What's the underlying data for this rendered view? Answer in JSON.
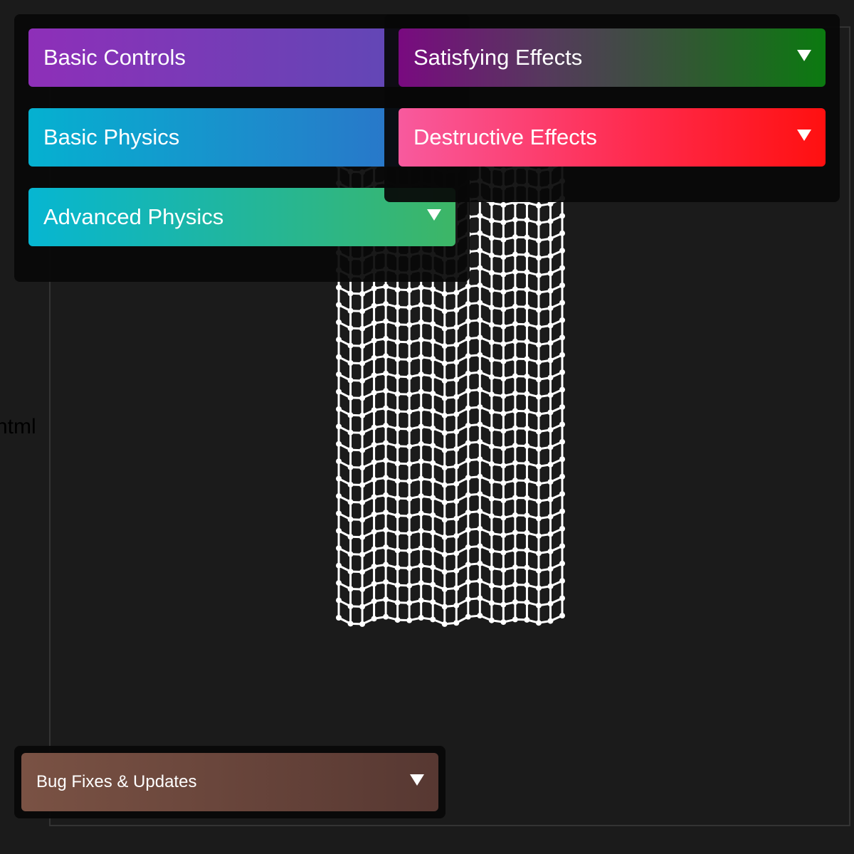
{
  "app": {
    "stray_text": "html"
  },
  "menu": {
    "left_column": [
      {
        "label": "Basic Controls",
        "has_arrow": false
      },
      {
        "label": "Basic Physics",
        "has_arrow": false
      },
      {
        "label": "Advanced Physics",
        "has_arrow": true
      }
    ],
    "right_column": [
      {
        "label": "Satisfying Effects",
        "has_arrow": true
      },
      {
        "label": "Destructive Effects",
        "has_arrow": true
      }
    ],
    "bottom": {
      "label": "Bug Fixes & Updates",
      "has_arrow": true
    }
  },
  "icons": {
    "dropdown": "triangle-down-icon"
  },
  "colors": {
    "background": "#1b1b1b",
    "cloth": "#ffffff",
    "panel": "#080808"
  },
  "simulation": {
    "type": "cloth",
    "columns": 20,
    "rows": 27
  }
}
